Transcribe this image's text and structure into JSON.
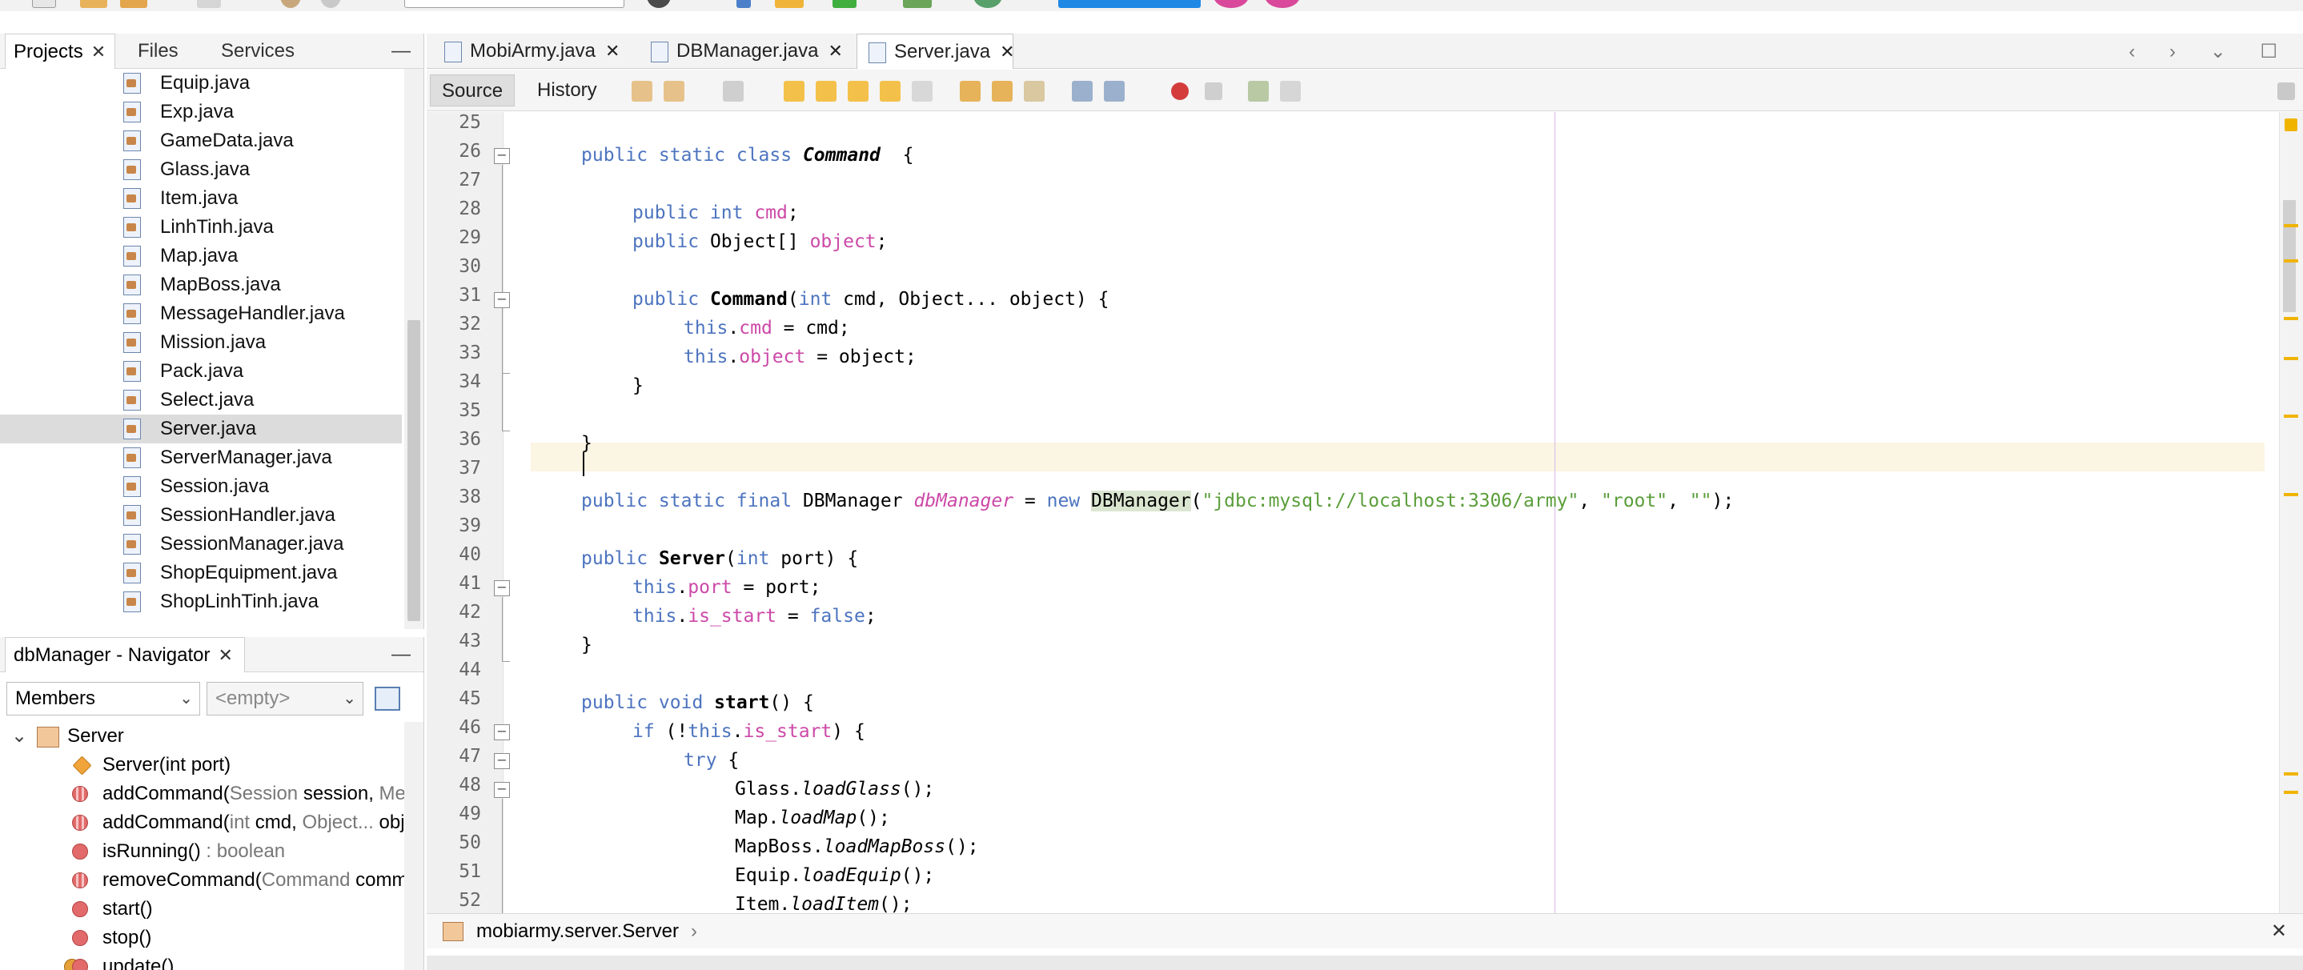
{
  "projects_panel": {
    "tabs": [
      {
        "label": "Projects",
        "close": "✕"
      },
      {
        "label": "Files"
      },
      {
        "label": "Services"
      }
    ],
    "minimize": "—",
    "files": [
      "Equip.java",
      "Exp.java",
      "GameData.java",
      "Glass.java",
      "Item.java",
      "LinhTinh.java",
      "Map.java",
      "MapBoss.java",
      "MessageHandler.java",
      "Mission.java",
      "Pack.java",
      "Select.java",
      "Server.java",
      "ServerManager.java",
      "Session.java",
      "SessionHandler.java",
      "SessionManager.java",
      "ShopEquipment.java",
      "ShopLinhTinh.java"
    ],
    "selected": "Server.java"
  },
  "navigator": {
    "title": "dbManager - Navigator",
    "close": "✕",
    "minimize": "—",
    "filter_value": "Members",
    "secondary_value": "<empty>",
    "root": "Server",
    "members": [
      {
        "name": "Server(",
        "params": "int port",
        ")": ")",
        "type": ""
      },
      {
        "name": "addCommand(",
        "params": "Session ",
        "bold": "session, ",
        "muted": "Mes"
      },
      {
        "name": "addCommand(",
        "params": "int ",
        "bold": "cmd, ",
        "muted": "Object... ",
        "bold2": "obj"
      },
      {
        "name": "isRunning()",
        "muted": " : boolean"
      },
      {
        "name": "removeCommand(",
        "params": "Command ",
        "bold": "comm"
      },
      {
        "name": "start()"
      },
      {
        "name": "stop()"
      },
      {
        "name": "update()"
      }
    ]
  },
  "editor": {
    "tabs": [
      "MobiArmy.java",
      "DBManager.java",
      "Server.java"
    ],
    "active_tab": "Server.java",
    "views": [
      "Source",
      "History"
    ],
    "active_view": "Source",
    "nav_arrows": "‹ › ⌄ ☐",
    "breadcrumb": "mobiarmy.server.Server",
    "close_bar": "✕",
    "line_numbers": [
      "25",
      "26",
      "27",
      "28",
      "29",
      "30",
      "31",
      "32",
      "33",
      "34",
      "35",
      "36",
      "37",
      "38",
      "39",
      "40",
      "41",
      "42",
      "43",
      "44",
      "45",
      "46",
      "47",
      "48",
      "49",
      "50",
      "51",
      "52"
    ],
    "code": {
      "l26": [
        "public static class ",
        "Command",
        "  {"
      ],
      "l28": [
        "public int ",
        "cmd",
        ";"
      ],
      "l29": [
        "public ",
        "Object[] ",
        "object",
        ";"
      ],
      "l31": [
        "public ",
        "Command",
        "(",
        "int",
        " cmd, Object... object) {"
      ],
      "l32": [
        "this",
        ".",
        "cmd",
        " = cmd;"
      ],
      "l33": [
        "this",
        ".",
        "object",
        " = object;"
      ],
      "l34": "}",
      "l36": "}",
      "l38": [
        "public static final ",
        "DBManager ",
        "dbManager",
        " = ",
        "new ",
        "DBManager",
        "(",
        "\"jdbc:mysql://localhost:3306/army\"",
        ", ",
        "\"root\"",
        ", ",
        "\"\"",
        ");"
      ],
      "l40": [
        "public ",
        "Server",
        "(",
        "int",
        " port) {"
      ],
      "l41": [
        "this",
        ".",
        "port",
        " = port;"
      ],
      "l42": [
        "this",
        ".",
        "is_start",
        " = ",
        "false",
        ";"
      ],
      "l43": "}",
      "l45": [
        "public void ",
        "start",
        "() {"
      ],
      "l46": [
        "if",
        " (!",
        "this",
        ".",
        "is_start",
        ") {"
      ],
      "l47": [
        "try",
        " {"
      ],
      "l48": [
        "Glass.",
        "loadGlass",
        "();"
      ],
      "l49": [
        "Map.",
        "loadMap",
        "();"
      ],
      "l50": [
        "MapBoss.",
        "loadMapBoss",
        "();"
      ],
      "l51": [
        "Equip.",
        "loadEquip",
        "();"
      ],
      "l52": [
        "Item.",
        "loadItem",
        "();"
      ]
    }
  },
  "colors": {
    "keyword": "#4d74bf",
    "field": "#cc49a8",
    "string": "#5a9e3a",
    "current_line": "#fbf5e3",
    "selection": "#dcdcdc"
  }
}
